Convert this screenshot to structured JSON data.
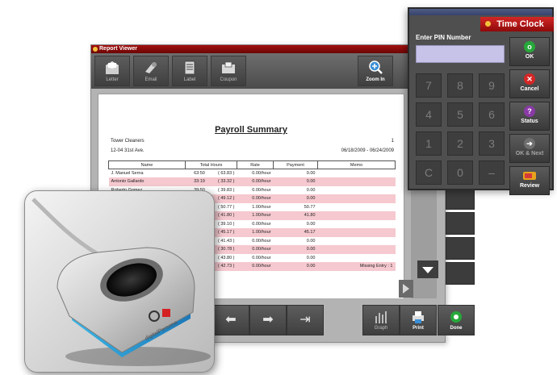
{
  "report_viewer": {
    "title": "Report Viewer",
    "toolbar": {
      "letter": "Letter",
      "email": "Email",
      "label": "Label",
      "coupon": "Coupon",
      "zoom_in": "Zoom In"
    },
    "report": {
      "title": "Payroll Summary",
      "company": "Tower Cleaners",
      "address": "12-04 31st Ave.",
      "page": "1",
      "date_range": "06/18/2009 - 06/24/2009",
      "columns": [
        "Name",
        "Total Hours",
        "Rate",
        "Payment",
        "Memo"
      ],
      "rows": [
        {
          "name": "J. Manuel Serna",
          "hours": "63:50",
          "paren": "( 63.83 )",
          "rate": "0.00/hour",
          "payment": "0.00",
          "memo": ""
        },
        {
          "name": "Antonio Gallardo",
          "hours": "33:19",
          "paren": "( 33.32 )",
          "rate": "0.00/hour",
          "payment": "0.00",
          "memo": ""
        },
        {
          "name": "Roberto Gomez",
          "hours": "39:50",
          "paren": "( 39.83 )",
          "rate": "0.00/hour",
          "payment": "0.00",
          "memo": ""
        },
        {
          "name": "",
          "hours": "",
          "paren": "( 49.12 )",
          "rate": "0.00/hour",
          "payment": "0.00",
          "memo": ""
        },
        {
          "name": "",
          "hours": "",
          "paren": "( 50.77 )",
          "rate": "1.00/hour",
          "payment": "50.77",
          "memo": ""
        },
        {
          "name": "",
          "hours": "",
          "paren": "( 41.80 )",
          "rate": "1.00/hour",
          "payment": "41.80",
          "memo": ""
        },
        {
          "name": "",
          "hours": "",
          "paren": "( 39.10 )",
          "rate": "0.00/hour",
          "payment": "0.00",
          "memo": ""
        },
        {
          "name": "",
          "hours": "",
          "paren": "( 45.17 )",
          "rate": "1.00/hour",
          "payment": "45.17",
          "memo": ""
        },
        {
          "name": "",
          "hours": "",
          "paren": "( 41.43 )",
          "rate": "0.00/hour",
          "payment": "0.00",
          "memo": ""
        },
        {
          "name": "",
          "hours": "",
          "paren": "( 30.78 )",
          "rate": "0.00/hour",
          "payment": "0.00",
          "memo": ""
        },
        {
          "name": "",
          "hours": "",
          "paren": "( 43.80 )",
          "rate": "0.00/hour",
          "payment": "0.00",
          "memo": ""
        },
        {
          "name": "",
          "hours": "",
          "paren": "( 42.73 )",
          "rate": "0.00/hour",
          "payment": "0.00",
          "memo": "Missing Entry : 1"
        }
      ]
    },
    "bottom": {
      "prev_icon": "arrow-left-icon",
      "next_icon": "arrow-right-icon",
      "last_icon": "arrow-last-icon",
      "graph": "Graph",
      "print": "Print",
      "done": "Done"
    }
  },
  "time_clock": {
    "title": "Time Clock",
    "pin_label": "Enter PIN Number",
    "pin_value": "",
    "keys": [
      "7",
      "8",
      "9",
      "4",
      "5",
      "6",
      "1",
      "2",
      "3",
      "C",
      "0",
      "–"
    ],
    "buttons": {
      "ok": "OK",
      "cancel": "Cancel",
      "status": "Status",
      "ok_next": "OK & Next",
      "review": "Review"
    }
  },
  "colors": {
    "accent_red": "#c41616",
    "pin_field": "#c7c2e8",
    "ok_green": "#27a83a",
    "cancel_red": "#d52626",
    "status_purple": "#8a3aa6",
    "row_highlight": "#f5c9cf"
  },
  "photo": {
    "subject": "fingerprint-reader",
    "brand_text": "digitalPersona"
  }
}
